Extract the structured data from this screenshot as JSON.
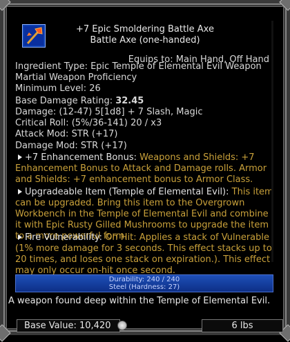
{
  "item": {
    "name": "+7 Epic Smoldering Battle Axe",
    "subtitle": "Battle Axe (one-handed)",
    "equips_to": "Equips to: Main Hand, Off Hand",
    "ingredient": "Ingredient Type: Epic Temple of Elemental Evil Weapon",
    "proficiency": "Martial Weapon Proficiency",
    "min_level": "Minimum Level: 26",
    "base_damage_label": "Base Damage Rating:",
    "base_damage_value": "32.45",
    "damage": "Damage: (12-47) 5[1d8] + 7 Slash, Magic",
    "critical": "Critical Roll: (5%/36-141) 20 / x3",
    "attack_mod": "Attack Mod: STR (+17)",
    "damage_mod": "Damage Mod: STR (+17)"
  },
  "effects": [
    {
      "name": "+7 Enhancement Bonus:",
      "text": " Weapons and Shields: +7 Enhancement Bonus to Attack and Damage rolls. Armor and Shields: +7 enhancement bonus to Armor Class."
    },
    {
      "name": "Upgradeable Item (Temple of Elemental Evil):",
      "text": " This item can be upgraded. Bring this item to the Overgrown Workbench in the Temple of Elemental Evil and combine it with Epic Rusty Gilled Mushrooms to upgrade the item to a more powerful form."
    },
    {
      "name": "Fire Vulnerability:",
      "text": " On Hit: Applies a stack of Vulnerable (1% more damage for 3 seconds. This effect stacks up to 20 times, and loses one stack on expiration.). This effect may only occur on-hit once second."
    }
  ],
  "durability": {
    "text": "Durability: 240 / 240",
    "steel": "Steel (Hardness: 27)",
    "fraction": 1.0
  },
  "description": "A weapon found deep within the Temple of Elemental Evil.",
  "footer": {
    "base_value": "Base Value: 10,420",
    "weight": "6 lbs"
  },
  "icons": {
    "item": "battle-axe-icon",
    "coin": "coin-icon"
  },
  "colors": {
    "effect_name": "#ffffff",
    "effect_text": "#c9a13a",
    "durability_bar": "#1e4fb8"
  }
}
